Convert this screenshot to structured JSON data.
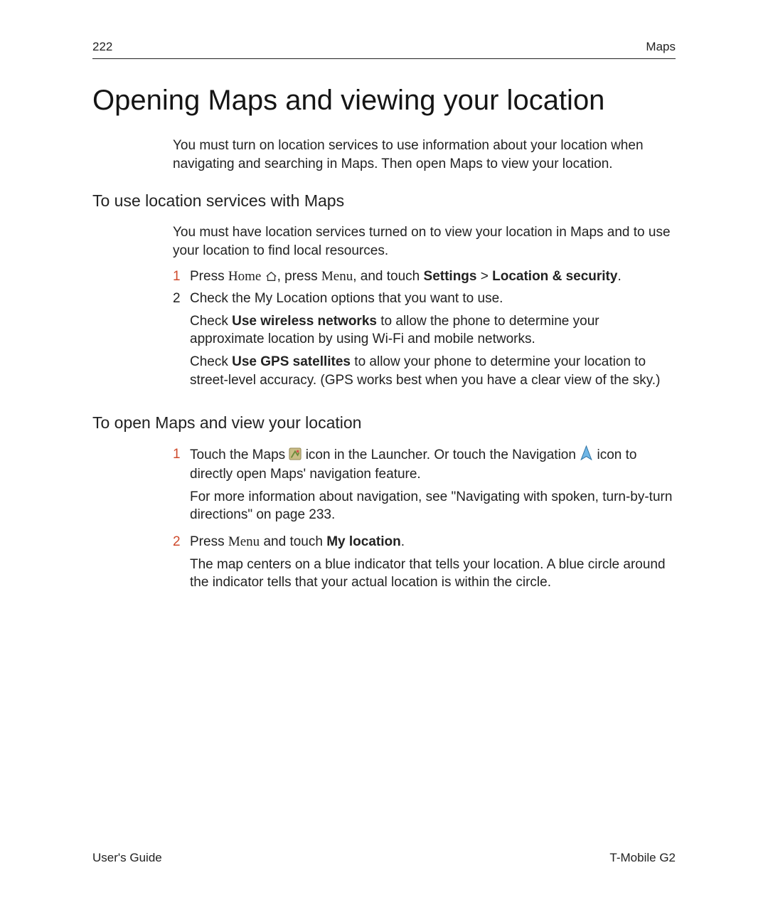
{
  "header": {
    "page_number": "222",
    "section": "Maps"
  },
  "title": "Opening Maps and viewing your location",
  "intro": "You must turn on location services to use information about your location when navigating and searching in Maps. Then open Maps to view your location.",
  "section1": {
    "heading": "To use location services with Maps",
    "intro": "You must have location services turned on to view your location in Maps and to use your location to find local resources.",
    "step1": {
      "num": "1",
      "t1": "Press ",
      "home": "Home",
      "t2": ", press ",
      "menu": "Menu",
      "t3": ", and touch ",
      "settings": "Settings",
      "gt": " > ",
      "loc_sec": "Location & security",
      "dot": "."
    },
    "step2": {
      "num": "2",
      "line1": "Check the My Location options that you want to use.",
      "p2a": "Check ",
      "p2b": "Use wireless networks",
      "p2c": " to allow the phone to determine your approximate location by using Wi-Fi and mobile networks.",
      "p3a": "Check ",
      "p3b": "Use GPS satellites",
      "p3c": " to allow your phone to determine your location to street-level accuracy. (GPS works best when you have a clear view of the sky.)"
    }
  },
  "section2": {
    "heading": "To open Maps and view your location",
    "step1": {
      "num": "1",
      "t1": "Touch the Maps ",
      "t2": " icon in the Launcher. Or touch the Navigation ",
      "t3": " icon to directly open Maps' navigation feature.",
      "p2": "For more information about navigation, see \"Navigating with spoken, turn-by-turn directions\" on page 233."
    },
    "step2": {
      "num": "2",
      "t1": "Press ",
      "menu": "Menu",
      "t2": " and touch ",
      "myloc": "My location",
      "dot": ".",
      "p2": "The map centers on a blue indicator that tells your location. A blue circle around the indicator tells that your actual location is within the circle."
    }
  },
  "footer": {
    "left": "User's Guide",
    "right": "T-Mobile G2"
  }
}
